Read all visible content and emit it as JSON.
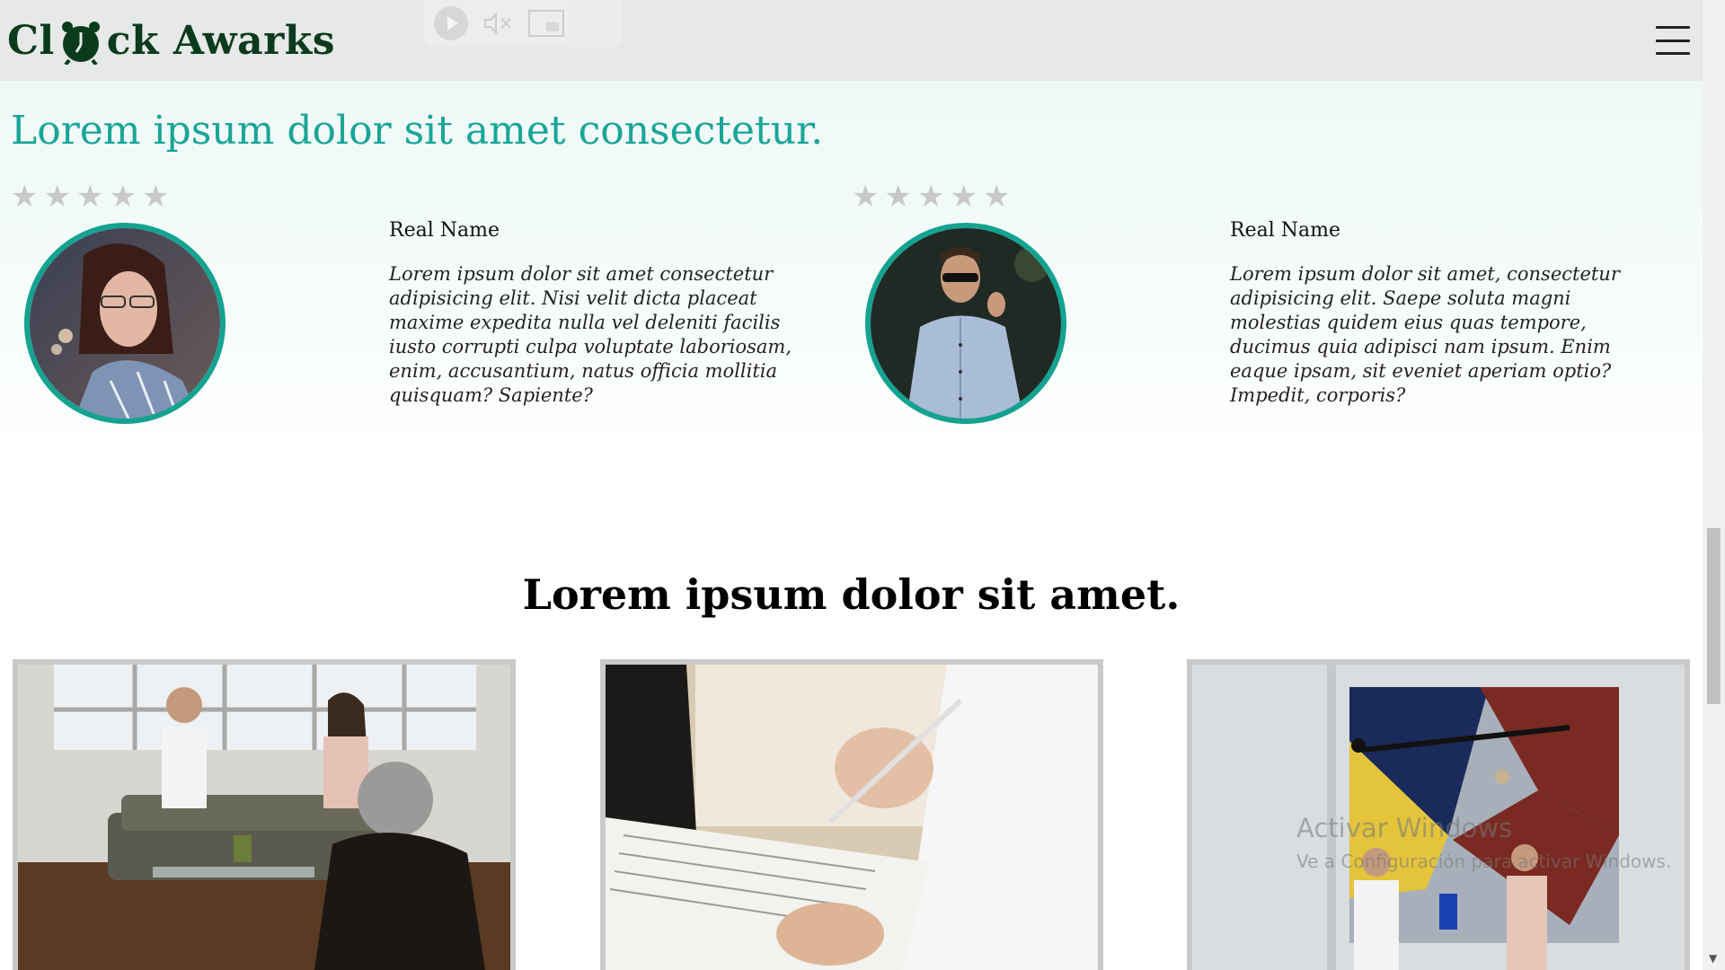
{
  "header": {
    "logo_left": "Cl",
    "logo_right": "ck Awarks",
    "menu_icon": "hamburger-menu-icon"
  },
  "testimonials": {
    "heading": "Lorem ipsum dolor sit amet consectetur.",
    "star_glyph": "★",
    "cards": [
      {
        "rating_of_5": 0,
        "name": "Real Name",
        "text": " Lorem ipsum dolor sit amet consectetur adipisicing elit. Nisi velit dicta placeat maxime expedita nulla vel deleniti facilis iusto corrupti culpa voluptate laboriosam, enim, accusantium, natus officia mollitia quisquam? Sapiente?"
      },
      {
        "rating_of_5": 0,
        "name": "Real Name",
        "text": " Lorem ipsum dolor sit amet, consectetur adipisicing elit. Saepe soluta magni molestias quidem eius quas tempore, ducimus quia adipisci nam ipsum. Enim eaque ipsam, sit eveniet aperiam optio? Impedit, corporis?"
      }
    ]
  },
  "section2": {
    "heading": "Lorem ipsum dolor sit amet."
  },
  "watermark": {
    "title": "Activar Windows",
    "subtitle": "Ve a Configuración para activar Windows."
  },
  "colors": {
    "accent": "#1aa597",
    "avatar_ring": "#14a390",
    "logo": "#0b3b1c",
    "header_bg": "#e6e9e7",
    "star_inactive": "#c8c8c8"
  }
}
